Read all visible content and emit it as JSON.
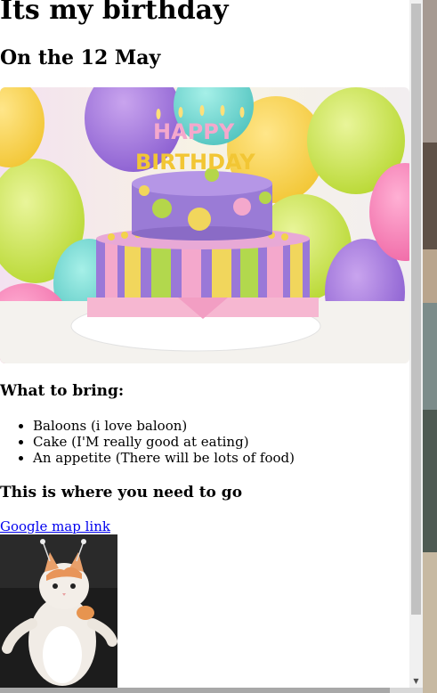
{
  "page": {
    "title": "Its my birthday",
    "subtitle": "On the 12 May",
    "bring_heading": "What to bring:",
    "bring_items": [
      "Baloons (i love baloon)",
      "Cake (I'M really good at eating)",
      "An appetite (There will be lots of food)"
    ],
    "go_heading": "This is where you need to go",
    "map_link": "Google map link"
  },
  "images": {
    "cake_text_line1": "HAPPY",
    "cake_text_line2": "BIRTHDAY"
  },
  "icons": {
    "scroll_up": "triangle-up-icon",
    "scroll_down": "triangle-down-icon"
  },
  "colors": {
    "link": "#0000ee"
  }
}
